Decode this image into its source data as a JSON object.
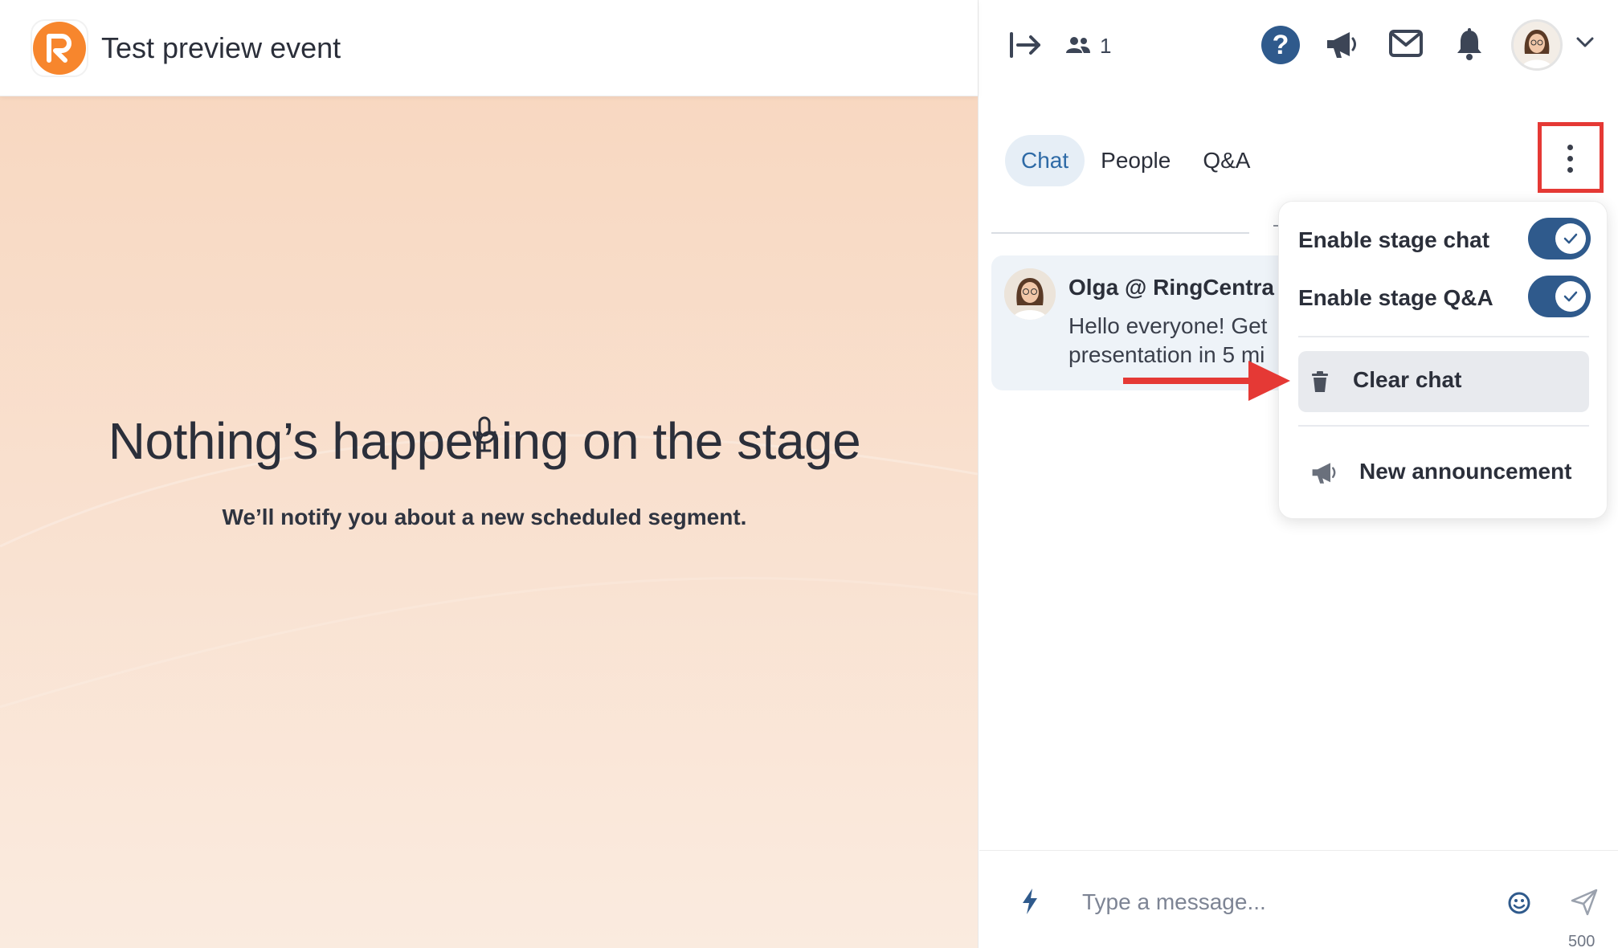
{
  "header": {
    "event_title": "Test preview event",
    "logo_icon": "ringcentral-logo-icon"
  },
  "stage": {
    "headline": "Nothing’s happening on the stage",
    "subtitle": "We’ll notify you about a new scheduled segment."
  },
  "right_header": {
    "attendee_count": "1",
    "help_label": "?"
  },
  "tabs": [
    {
      "label": "Chat",
      "active": true
    },
    {
      "label": "People",
      "active": false
    },
    {
      "label": "Q&A",
      "active": false
    }
  ],
  "message": {
    "author": "Olga @ RingCentra",
    "text": "Hello everyone! Get presentation in 5 mi"
  },
  "menu": {
    "enable_stage_chat": "Enable stage chat",
    "enable_stage_chat_on": true,
    "enable_stage_qa": "Enable stage Q&A",
    "enable_stage_qa_on": true,
    "clear_chat": "Clear chat",
    "new_announcement": "New announcement"
  },
  "composer": {
    "placeholder": "Type a message...",
    "char_limit": "500"
  },
  "colors": {
    "brand_orange": "#f7862d",
    "accent_blue": "#2f5a8c",
    "highlight_red": "#e53935"
  }
}
